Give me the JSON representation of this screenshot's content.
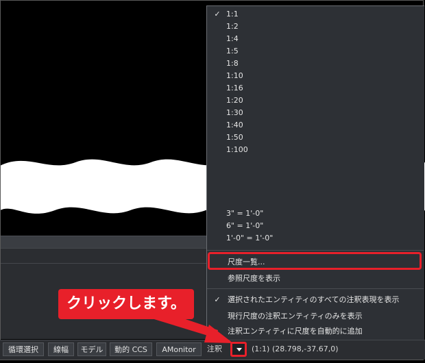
{
  "scale_menu": {
    "items": [
      {
        "label": "1:1",
        "checked": true
      },
      {
        "label": "1:2",
        "checked": false
      },
      {
        "label": "1:4",
        "checked": false
      },
      {
        "label": "1:5",
        "checked": false
      },
      {
        "label": "1:8",
        "checked": false
      },
      {
        "label": "1:10",
        "checked": false
      },
      {
        "label": "1:16",
        "checked": false
      },
      {
        "label": "1:20",
        "checked": false
      },
      {
        "label": "1:30",
        "checked": false
      },
      {
        "label": "1:40",
        "checked": false
      },
      {
        "label": "1:50",
        "checked": false
      },
      {
        "label": "1:100",
        "checked": false
      }
    ],
    "imperial_items": [
      {
        "label": "3\" = 1'-0\""
      },
      {
        "label": "6\" = 1'-0\""
      },
      {
        "label": "1'-0\" = 1'-0\""
      }
    ],
    "scale_list": "尺度一覧...",
    "show_reference_scale": "参照尺度を表示",
    "show_all_annotations": "選択されたエンティティのすべての注釈表現を表示",
    "show_current_scale_only": "現行尺度の注釈エンティティのみを表示",
    "auto_add_scale": "注釈エンティティに尺度を自動的に追加"
  },
  "statusbar": {
    "buttons": [
      "循環選択",
      "線幅",
      "モデル",
      "動的 CCS",
      "AMonitor"
    ],
    "annotation_label": "注釈",
    "current_scale": "(1:1)",
    "coordinates": "(28.798,-37.67,0)"
  },
  "callout": {
    "text": "クリックします。"
  },
  "colors": {
    "accent_red": "#e8202a",
    "menu_bg": "#2d3035"
  }
}
